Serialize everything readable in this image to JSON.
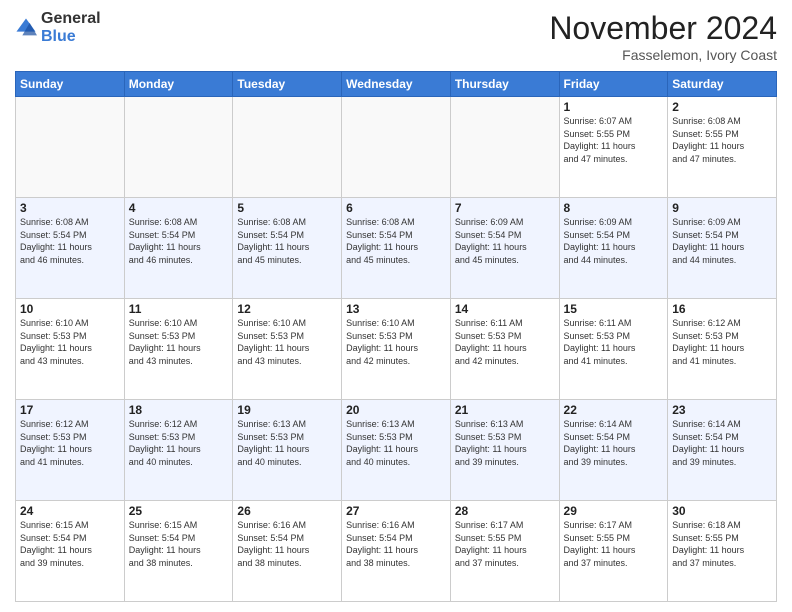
{
  "header": {
    "logo_general": "General",
    "logo_blue": "Blue",
    "month": "November 2024",
    "location": "Fasselemon, Ivory Coast"
  },
  "weekdays": [
    "Sunday",
    "Monday",
    "Tuesday",
    "Wednesday",
    "Thursday",
    "Friday",
    "Saturday"
  ],
  "weeks": [
    [
      {
        "day": "",
        "info": ""
      },
      {
        "day": "",
        "info": ""
      },
      {
        "day": "",
        "info": ""
      },
      {
        "day": "",
        "info": ""
      },
      {
        "day": "",
        "info": ""
      },
      {
        "day": "1",
        "info": "Sunrise: 6:07 AM\nSunset: 5:55 PM\nDaylight: 11 hours\nand 47 minutes."
      },
      {
        "day": "2",
        "info": "Sunrise: 6:08 AM\nSunset: 5:55 PM\nDaylight: 11 hours\nand 47 minutes."
      }
    ],
    [
      {
        "day": "3",
        "info": "Sunrise: 6:08 AM\nSunset: 5:54 PM\nDaylight: 11 hours\nand 46 minutes."
      },
      {
        "day": "4",
        "info": "Sunrise: 6:08 AM\nSunset: 5:54 PM\nDaylight: 11 hours\nand 46 minutes."
      },
      {
        "day": "5",
        "info": "Sunrise: 6:08 AM\nSunset: 5:54 PM\nDaylight: 11 hours\nand 45 minutes."
      },
      {
        "day": "6",
        "info": "Sunrise: 6:08 AM\nSunset: 5:54 PM\nDaylight: 11 hours\nand 45 minutes."
      },
      {
        "day": "7",
        "info": "Sunrise: 6:09 AM\nSunset: 5:54 PM\nDaylight: 11 hours\nand 45 minutes."
      },
      {
        "day": "8",
        "info": "Sunrise: 6:09 AM\nSunset: 5:54 PM\nDaylight: 11 hours\nand 44 minutes."
      },
      {
        "day": "9",
        "info": "Sunrise: 6:09 AM\nSunset: 5:54 PM\nDaylight: 11 hours\nand 44 minutes."
      }
    ],
    [
      {
        "day": "10",
        "info": "Sunrise: 6:10 AM\nSunset: 5:53 PM\nDaylight: 11 hours\nand 43 minutes."
      },
      {
        "day": "11",
        "info": "Sunrise: 6:10 AM\nSunset: 5:53 PM\nDaylight: 11 hours\nand 43 minutes."
      },
      {
        "day": "12",
        "info": "Sunrise: 6:10 AM\nSunset: 5:53 PM\nDaylight: 11 hours\nand 43 minutes."
      },
      {
        "day": "13",
        "info": "Sunrise: 6:10 AM\nSunset: 5:53 PM\nDaylight: 11 hours\nand 42 minutes."
      },
      {
        "day": "14",
        "info": "Sunrise: 6:11 AM\nSunset: 5:53 PM\nDaylight: 11 hours\nand 42 minutes."
      },
      {
        "day": "15",
        "info": "Sunrise: 6:11 AM\nSunset: 5:53 PM\nDaylight: 11 hours\nand 41 minutes."
      },
      {
        "day": "16",
        "info": "Sunrise: 6:12 AM\nSunset: 5:53 PM\nDaylight: 11 hours\nand 41 minutes."
      }
    ],
    [
      {
        "day": "17",
        "info": "Sunrise: 6:12 AM\nSunset: 5:53 PM\nDaylight: 11 hours\nand 41 minutes."
      },
      {
        "day": "18",
        "info": "Sunrise: 6:12 AM\nSunset: 5:53 PM\nDaylight: 11 hours\nand 40 minutes."
      },
      {
        "day": "19",
        "info": "Sunrise: 6:13 AM\nSunset: 5:53 PM\nDaylight: 11 hours\nand 40 minutes."
      },
      {
        "day": "20",
        "info": "Sunrise: 6:13 AM\nSunset: 5:53 PM\nDaylight: 11 hours\nand 40 minutes."
      },
      {
        "day": "21",
        "info": "Sunrise: 6:13 AM\nSunset: 5:53 PM\nDaylight: 11 hours\nand 39 minutes."
      },
      {
        "day": "22",
        "info": "Sunrise: 6:14 AM\nSunset: 5:54 PM\nDaylight: 11 hours\nand 39 minutes."
      },
      {
        "day": "23",
        "info": "Sunrise: 6:14 AM\nSunset: 5:54 PM\nDaylight: 11 hours\nand 39 minutes."
      }
    ],
    [
      {
        "day": "24",
        "info": "Sunrise: 6:15 AM\nSunset: 5:54 PM\nDaylight: 11 hours\nand 39 minutes."
      },
      {
        "day": "25",
        "info": "Sunrise: 6:15 AM\nSunset: 5:54 PM\nDaylight: 11 hours\nand 38 minutes."
      },
      {
        "day": "26",
        "info": "Sunrise: 6:16 AM\nSunset: 5:54 PM\nDaylight: 11 hours\nand 38 minutes."
      },
      {
        "day": "27",
        "info": "Sunrise: 6:16 AM\nSunset: 5:54 PM\nDaylight: 11 hours\nand 38 minutes."
      },
      {
        "day": "28",
        "info": "Sunrise: 6:17 AM\nSunset: 5:55 PM\nDaylight: 11 hours\nand 37 minutes."
      },
      {
        "day": "29",
        "info": "Sunrise: 6:17 AM\nSunset: 5:55 PM\nDaylight: 11 hours\nand 37 minutes."
      },
      {
        "day": "30",
        "info": "Sunrise: 6:18 AM\nSunset: 5:55 PM\nDaylight: 11 hours\nand 37 minutes."
      }
    ]
  ]
}
